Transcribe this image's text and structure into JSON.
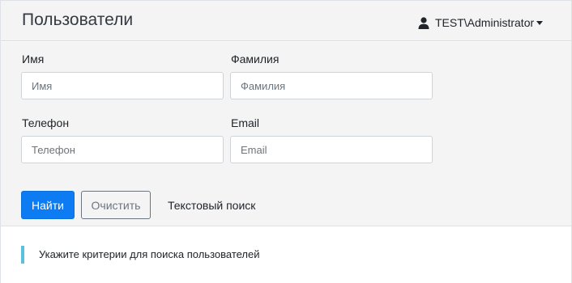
{
  "header": {
    "title": "Пользователи",
    "user": {
      "name": "TEST\\Administrator",
      "icon": "user-icon"
    }
  },
  "filters": {
    "first_name": {
      "label": "Имя",
      "placeholder": "Имя",
      "value": ""
    },
    "last_name": {
      "label": "Фамилия",
      "placeholder": "Фамилия",
      "value": ""
    },
    "phone": {
      "label": "Телефон",
      "placeholder": "Телефон",
      "value": ""
    },
    "email": {
      "label": "Email",
      "placeholder": "Email",
      "value": ""
    }
  },
  "actions": {
    "search_label": "Найти",
    "clear_label": "Очистить",
    "text_search_label": "Текстовый поиск"
  },
  "hint": {
    "text": "Укажите критерии для поиска пользователей"
  },
  "colors": {
    "primary": "#0d7bf2",
    "panel_background": "#f4f4f5",
    "hint_accent": "#5bc0de",
    "secondary": "#6c757d"
  }
}
